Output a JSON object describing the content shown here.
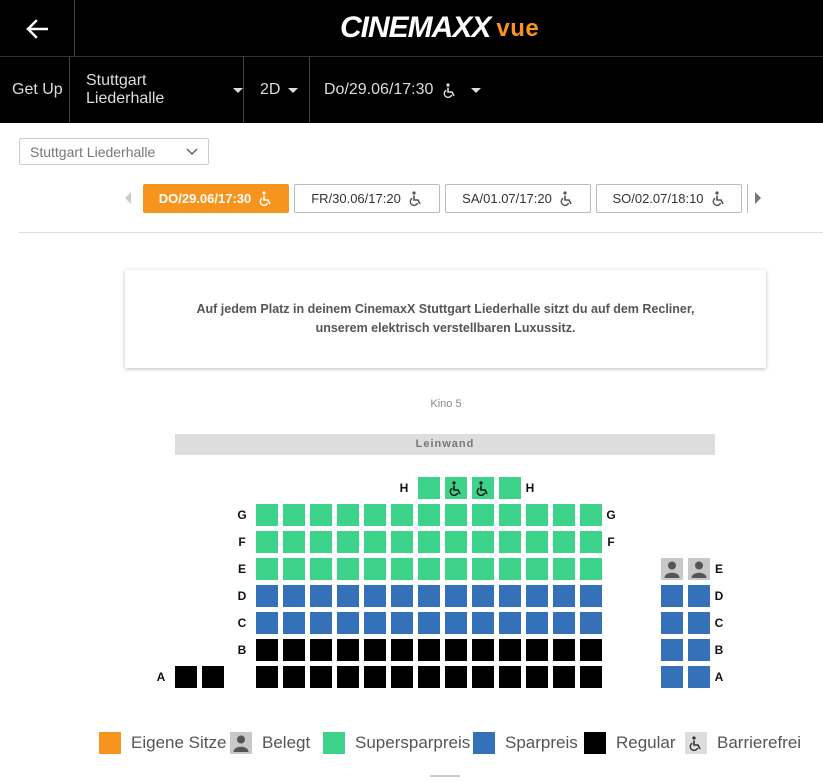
{
  "header": {
    "logo_main": "CINEMAXX",
    "logo_vue": "vue"
  },
  "nav": {
    "film": "Get Up",
    "cinema": "Stuttgart Liederhalle",
    "format": "2D",
    "showtime": "Do/29.06/17:30"
  },
  "cinema_select": {
    "value": "Stuttgart Liederhalle"
  },
  "dates": [
    {
      "label": "DO/29.06/17:30",
      "active": true
    },
    {
      "label": "FR/30.06/17:20",
      "active": false
    },
    {
      "label": "SA/01.07/17:20",
      "active": false
    },
    {
      "label": "SO/02.07/18:10",
      "active": false
    }
  ],
  "info_text": "Auf jedem Platz in deinem CinemaxX Stuttgart Liederhalle sitzt du auf dem Recliner, unserem elektrisch verstellbaren Luxussitz.",
  "hall_name": "Kino 5",
  "screen_label": "Leinwand",
  "colors": {
    "accent": "#f7941d",
    "supersparpreis": "#3ed38a",
    "sparpreis": "#3571b8",
    "regular": "#000000",
    "belegt": "#c8c8c8"
  },
  "seat_rows": [
    {
      "row": "H",
      "seats": [
        "super",
        "super-wc",
        "super-wc",
        "super"
      ]
    },
    {
      "row": "G",
      "seats": [
        "super",
        "super",
        "super",
        "super",
        "super",
        "super",
        "super",
        "super",
        "super",
        "super",
        "super",
        "super",
        "super"
      ]
    },
    {
      "row": "F",
      "seats": [
        "super",
        "super",
        "super",
        "super",
        "super",
        "super",
        "super",
        "super",
        "super",
        "super",
        "super",
        "super",
        "super"
      ]
    },
    {
      "row": "E",
      "seats": [
        "super",
        "super",
        "super",
        "super",
        "super",
        "super",
        "super",
        "super",
        "super",
        "super",
        "super",
        "super",
        "super"
      ],
      "right": [
        "occ",
        "occ"
      ]
    },
    {
      "row": "D",
      "seats": [
        "spar",
        "spar",
        "spar",
        "spar",
        "spar",
        "spar",
        "spar",
        "spar",
        "spar",
        "spar",
        "spar",
        "spar",
        "spar"
      ],
      "right": [
        "spar",
        "spar"
      ]
    },
    {
      "row": "C",
      "seats": [
        "spar",
        "spar",
        "spar",
        "spar",
        "spar",
        "spar",
        "spar",
        "spar",
        "spar",
        "spar",
        "spar",
        "spar",
        "spar"
      ],
      "right": [
        "spar",
        "spar"
      ]
    },
    {
      "row": "B",
      "seats": [
        "reg",
        "reg",
        "reg",
        "reg",
        "reg",
        "reg",
        "reg",
        "reg",
        "reg",
        "reg",
        "reg",
        "reg",
        "reg"
      ],
      "right": [
        "spar",
        "spar"
      ]
    },
    {
      "row": "A",
      "left": [
        "reg",
        "reg"
      ],
      "seats": [
        "reg",
        "reg",
        "reg",
        "reg",
        "reg",
        "reg",
        "reg",
        "reg",
        "reg",
        "reg",
        "reg",
        "reg",
        "reg"
      ],
      "right": [
        "spar",
        "spar"
      ]
    }
  ],
  "legend": [
    {
      "label": "Eigene Sitze",
      "type": "own"
    },
    {
      "label": "Belegt",
      "type": "occ"
    },
    {
      "label": "Supersparpreis",
      "type": "super"
    },
    {
      "label": "Sparpreis",
      "type": "spar"
    },
    {
      "label": "Regular",
      "type": "reg"
    },
    {
      "label": "Barrierefrei",
      "type": "wc"
    }
  ]
}
